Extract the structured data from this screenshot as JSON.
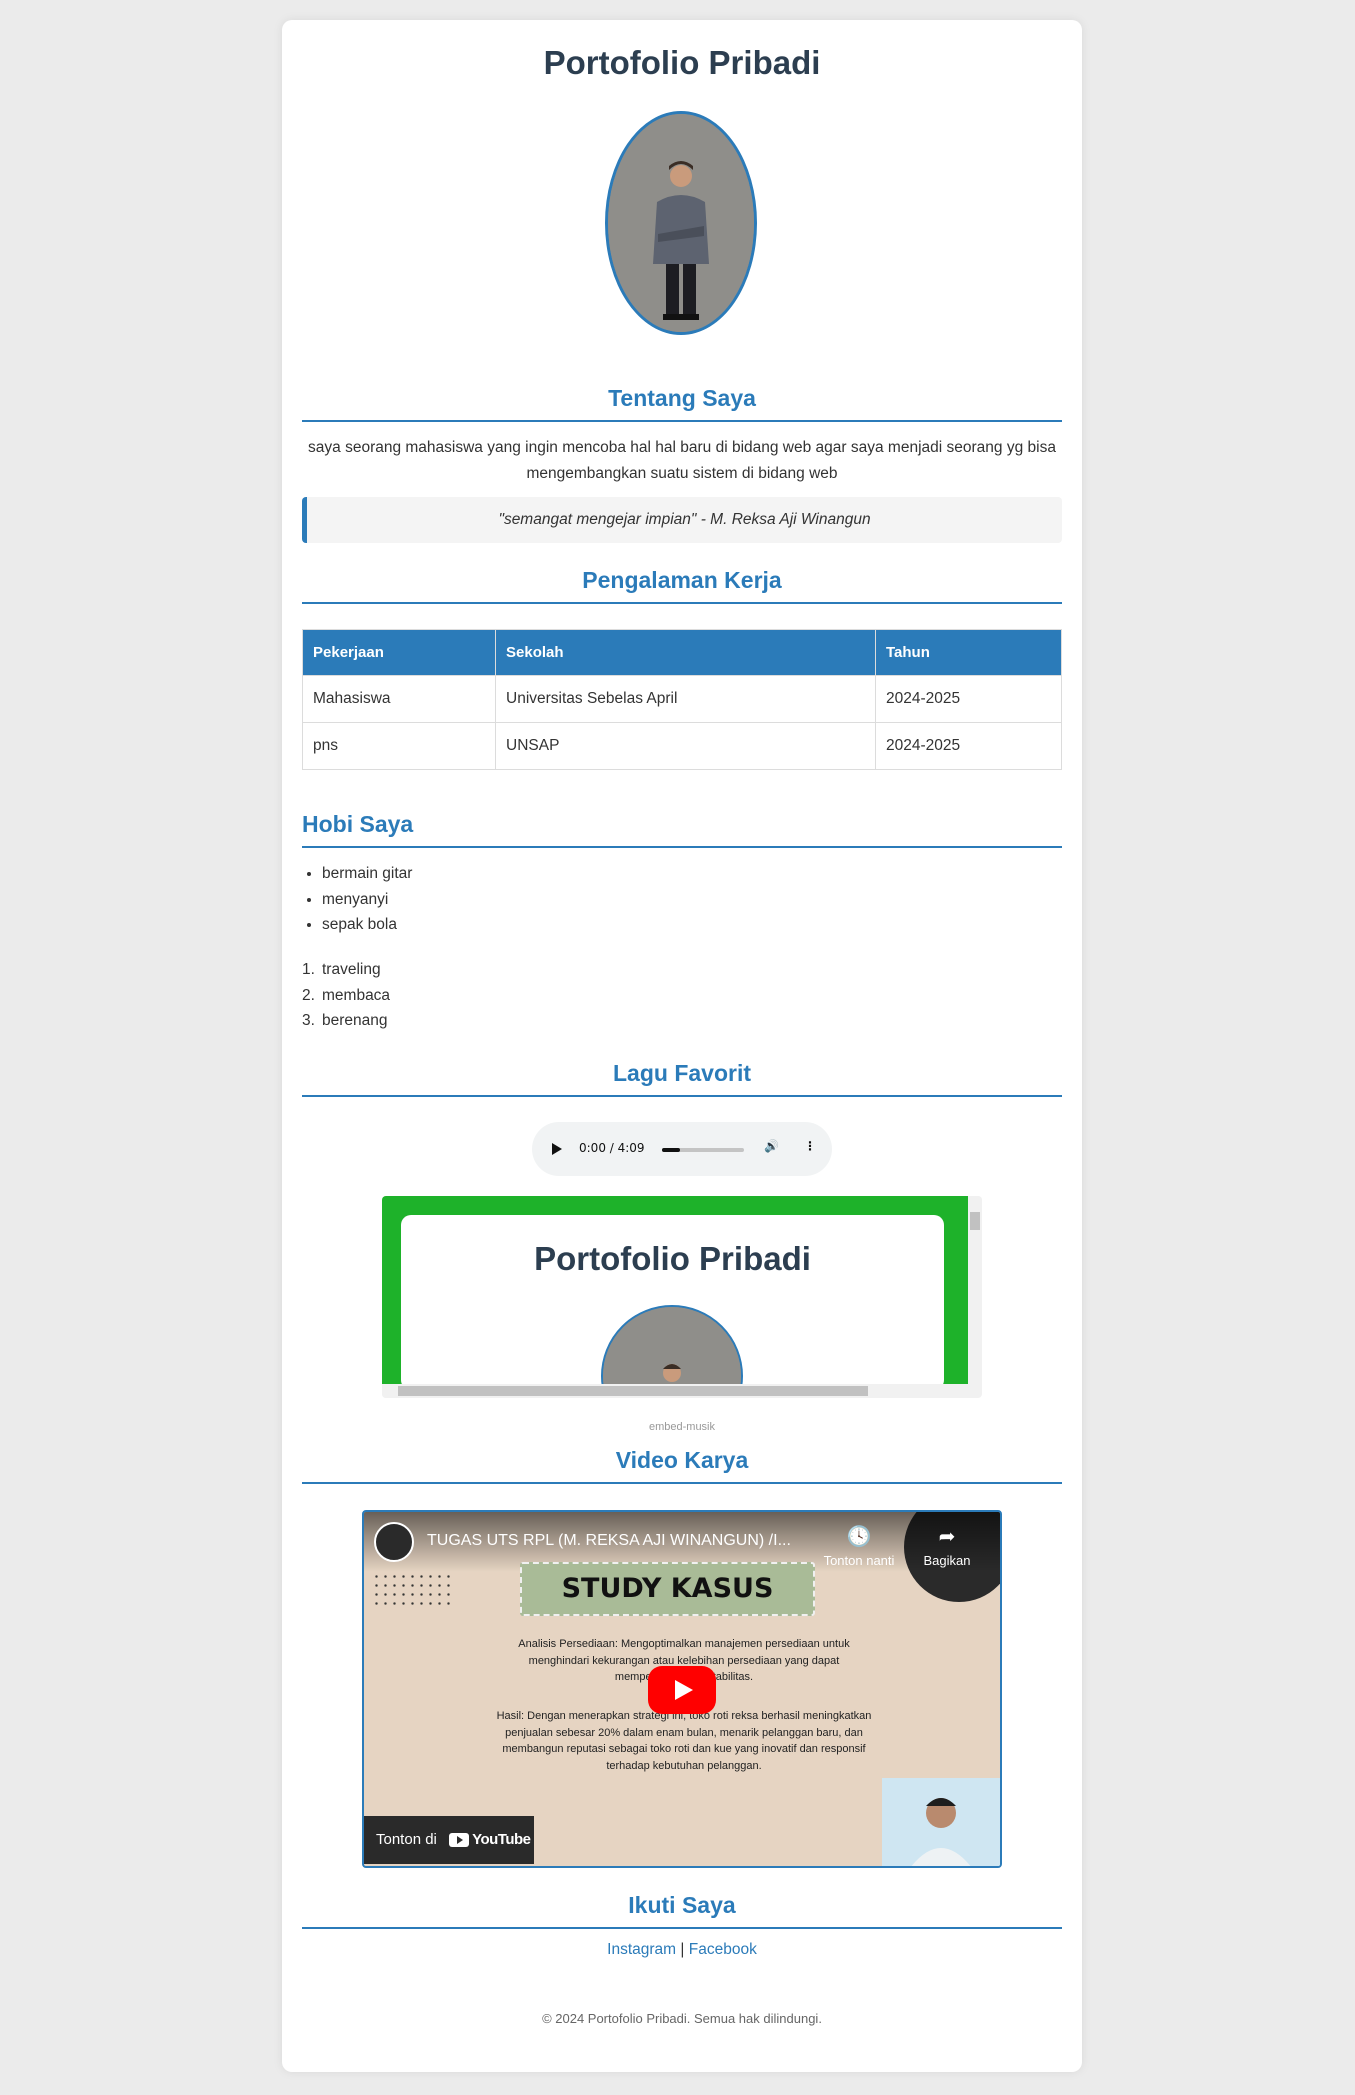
{
  "header": {
    "title": "Portofolio Pribadi"
  },
  "about": {
    "heading": "Tentang Saya",
    "text": "saya seorang mahasiswa yang ingin mencoba hal hal baru di bidang web agar saya menjadi seorang yg bisa mengembangkan suatu sistem di bidang web",
    "quote": "\"semangat mengejar impian\" - M. Reksa Aji Winangun"
  },
  "work": {
    "heading": "Pengalaman Kerja",
    "columns": [
      "Pekerjaan",
      "Sekolah",
      "Tahun"
    ],
    "rows": [
      [
        "Mahasiswa",
        "Universitas Sebelas April",
        "2024-2025"
      ],
      [
        "pns",
        "UNSAP",
        "2024-2025"
      ]
    ]
  },
  "hobbies": {
    "heading": "Hobi Saya",
    "bulleted": [
      "bermain gitar",
      "menyanyi",
      "sepak bola"
    ],
    "numbered": [
      "traveling",
      "membaca",
      "berenang"
    ]
  },
  "music": {
    "heading": "Lagu Favorit",
    "audio_time": "0:00 / 4:09",
    "audio_progress": 0.22,
    "embed_title": "Portofolio Pribadi",
    "embed_label": "embed-musik"
  },
  "video": {
    "heading": "Video Karya",
    "title": "TUGAS UTS RPL (M. REKSA AJI WINANGUN) /I...",
    "watch_later": "Tonton nanti",
    "share": "Bagikan",
    "banner": "STUDY KASUS",
    "para1": "Analisis Persediaan: Mengoptimalkan manajemen persediaan untuk menghindari kekurangan atau kelebihan persediaan yang dapat mempengaruhi profitabilitas.",
    "para2": "Hasil: Dengan menerapkan strategi ini, toko roti reksa berhasil meningkatkan penjualan sebesar 20% dalam enam bulan, menarik pelanggan baru, dan membangun reputasi sebagai toko roti dan kue yang inovatif dan responsif terhadap kebutuhan pelanggan.",
    "watch_on": "Tonton di",
    "youtube": "YouTube"
  },
  "social": {
    "heading": "Ikuti Saya",
    "links": [
      "Instagram",
      "Facebook"
    ],
    "separator": "|"
  },
  "footer": {
    "text": "© 2024 Portofolio Pribadi. Semua hak dilindungi."
  },
  "colors": {
    "accent": "#2b7bb9",
    "title": "#2c3e50",
    "embed_bg": "#1eb22a",
    "play": "#ff0000"
  }
}
